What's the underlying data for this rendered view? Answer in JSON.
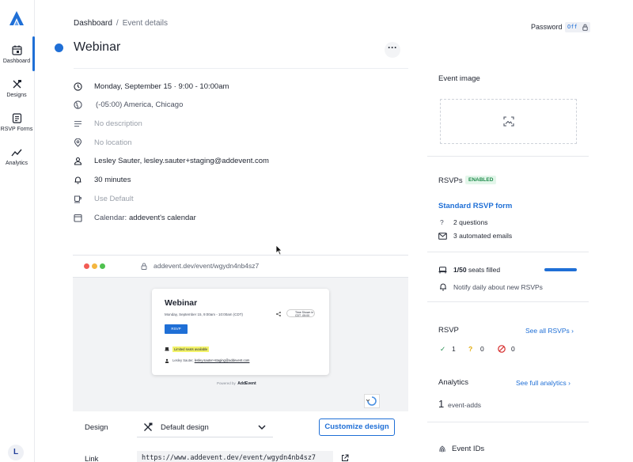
{
  "nav": {
    "items": [
      {
        "label": "Dashboard",
        "icon": "calendar-icon"
      },
      {
        "label": "Designs",
        "icon": "design-tools-icon"
      },
      {
        "label": "RSVP Forms",
        "icon": "form-icon"
      },
      {
        "label": "Analytics",
        "icon": "chart-line-icon"
      }
    ],
    "avatar": "L"
  },
  "breadcrumb": {
    "root": "Dashboard",
    "separator": "/",
    "current": "Event details"
  },
  "event": {
    "title": "Webinar",
    "color": "#1f6fd6",
    "details": {
      "datetime": "Monday, September 15 · 9:00 - 10:00am",
      "timezone": "(-05:00) America, Chicago",
      "description": "No description",
      "location": "No location",
      "host": "Lesley Sauter, lesley.sauter+staging@addevent.com",
      "reminder": "30 minutes",
      "theme": "Use Default",
      "calendar_label": "Calendar:",
      "calendar_value": "addevent's calendar"
    }
  },
  "preview": {
    "url": "addevent.dev/event/wgydn4nb4sz7",
    "card": {
      "title": "Webinar",
      "date": "Monday, September 15, 9:00am - 10:00am (CDT)",
      "button": "RSVP",
      "limited": "Limited seats available",
      "host_name": "Lesley Sauter,",
      "host_email": "lesley.sauter+staging@addevent.com",
      "tz_line1": "Time Shown in",
      "tz_line2": "CDT -05:00"
    },
    "powered_by": "Powered by",
    "brand": "AddEvent"
  },
  "design": {
    "label": "Design",
    "value": "Default design",
    "customize_button": "Customize design"
  },
  "link": {
    "label": "Link",
    "value": "https://www.addevent.dev/event/wgydn4nb4sz7"
  },
  "password": {
    "label": "Password",
    "toggle": "Off"
  },
  "right": {
    "event_image_title": "Event image",
    "rsvps_title": "RSVPs",
    "rsvps_badge": "ENABLED",
    "rsvp_form_link": "Standard RSVP form",
    "questions": "2 questions",
    "emails": "3 automated emails",
    "seats_count": "1/50",
    "seats_text": "seats filled",
    "seats_fill_fraction": 1.0,
    "notify": "Notify daily about new RSVPs",
    "rsvp_section": "RSVP",
    "see_all": "See all RSVPs",
    "yes_count": "1",
    "maybe_count": "0",
    "no_count": "0",
    "analytics_title": "Analytics",
    "see_analytics": "See full analytics",
    "adds_count": "1",
    "adds_label": "event-adds",
    "event_ids": "Event IDs"
  }
}
